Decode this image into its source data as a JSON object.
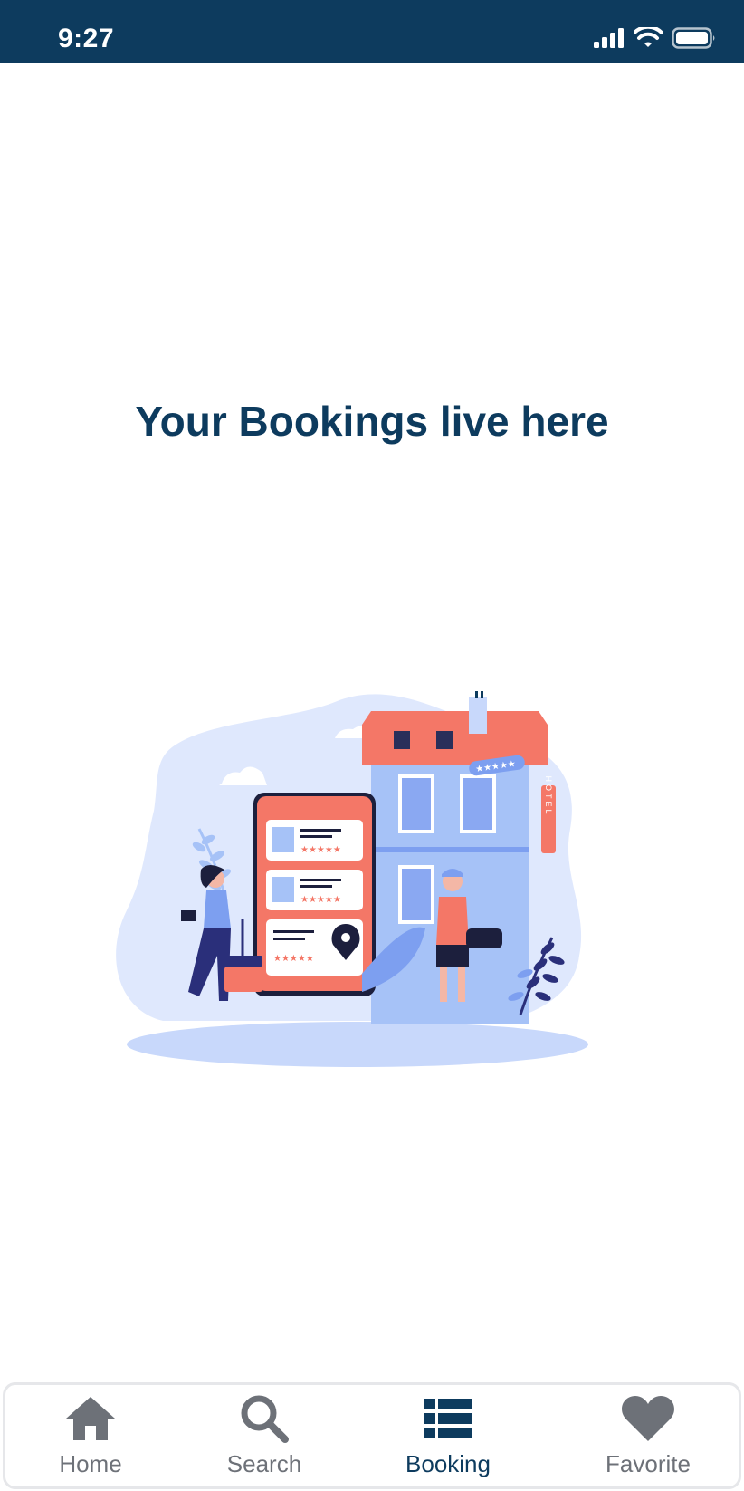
{
  "status_bar": {
    "time": "9:27"
  },
  "main": {
    "title": "Your Bookings live here",
    "illustration_icon": "hotel-booking-illustration",
    "illustration_sign": "HOTEL"
  },
  "tab_bar": {
    "active": "Booking",
    "tabs": [
      {
        "label": "Home",
        "icon": "home-icon"
      },
      {
        "label": "Search",
        "icon": "search-icon"
      },
      {
        "label": "Booking",
        "icon": "list-icon"
      },
      {
        "label": "Favorite",
        "icon": "heart-icon"
      }
    ]
  },
  "colors": {
    "primary": "#0d3b5e",
    "inactive_tab": "#6d7178",
    "accent_coral": "#f47767",
    "accent_blue": "#a6c2f7"
  }
}
